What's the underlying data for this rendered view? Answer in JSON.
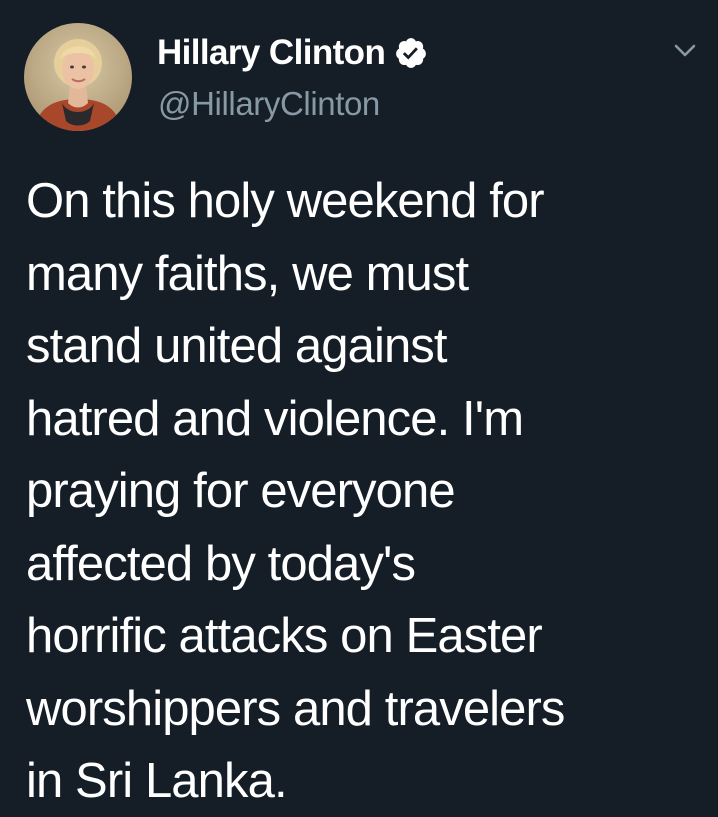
{
  "author": {
    "display_name": "Hillary Clinton",
    "handle": "@HillaryClinton",
    "verified": true,
    "avatar_icon": "profile-photo"
  },
  "menu_icon": "chevron-down-icon",
  "tweet": {
    "lines": [
      "On this holy weekend for",
      "many faiths, we must",
      "stand united against",
      "hatred and violence. I'm",
      "praying for everyone",
      "affected by today's",
      "horrific attacks on Easter",
      "worshippers and travelers",
      "in Sri Lanka."
    ]
  },
  "colors": {
    "background": "#151e27",
    "text": "#ffffff",
    "secondary_text": "#8899a6"
  }
}
